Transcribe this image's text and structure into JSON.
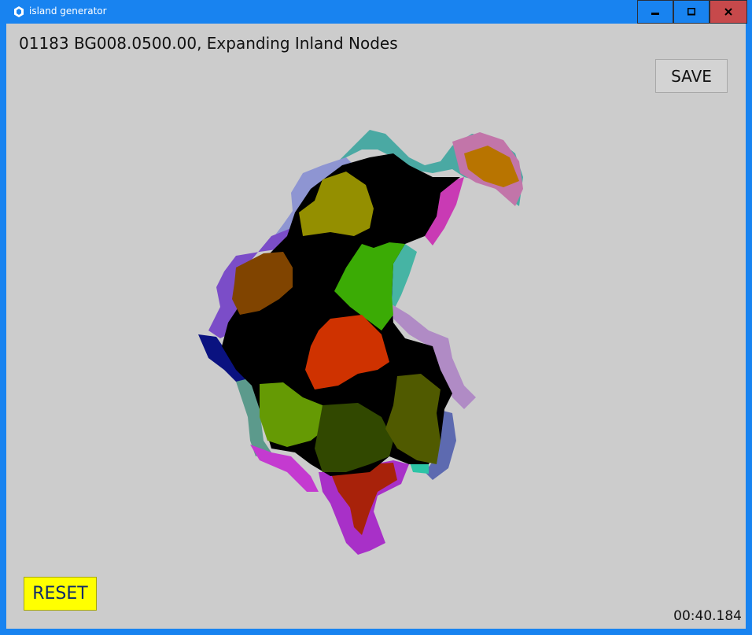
{
  "window": {
    "title": "island generator",
    "icon": "unity-icon"
  },
  "controls": {
    "minimize_icon": "minimize-icon",
    "maximize_icon": "maximize-icon",
    "close_icon": "close-icon"
  },
  "main": {
    "status": "01183 BG008.0500.00, Expanding Inland Nodes",
    "save_label": "SAVE",
    "reset_label": "RESET",
    "elapsed": "00:40.184"
  },
  "colors": {
    "titlebar": "#1883f0",
    "canvas": "#cccccc",
    "close": "#c7494b",
    "reset": "#ffff00",
    "land": "#000000"
  }
}
